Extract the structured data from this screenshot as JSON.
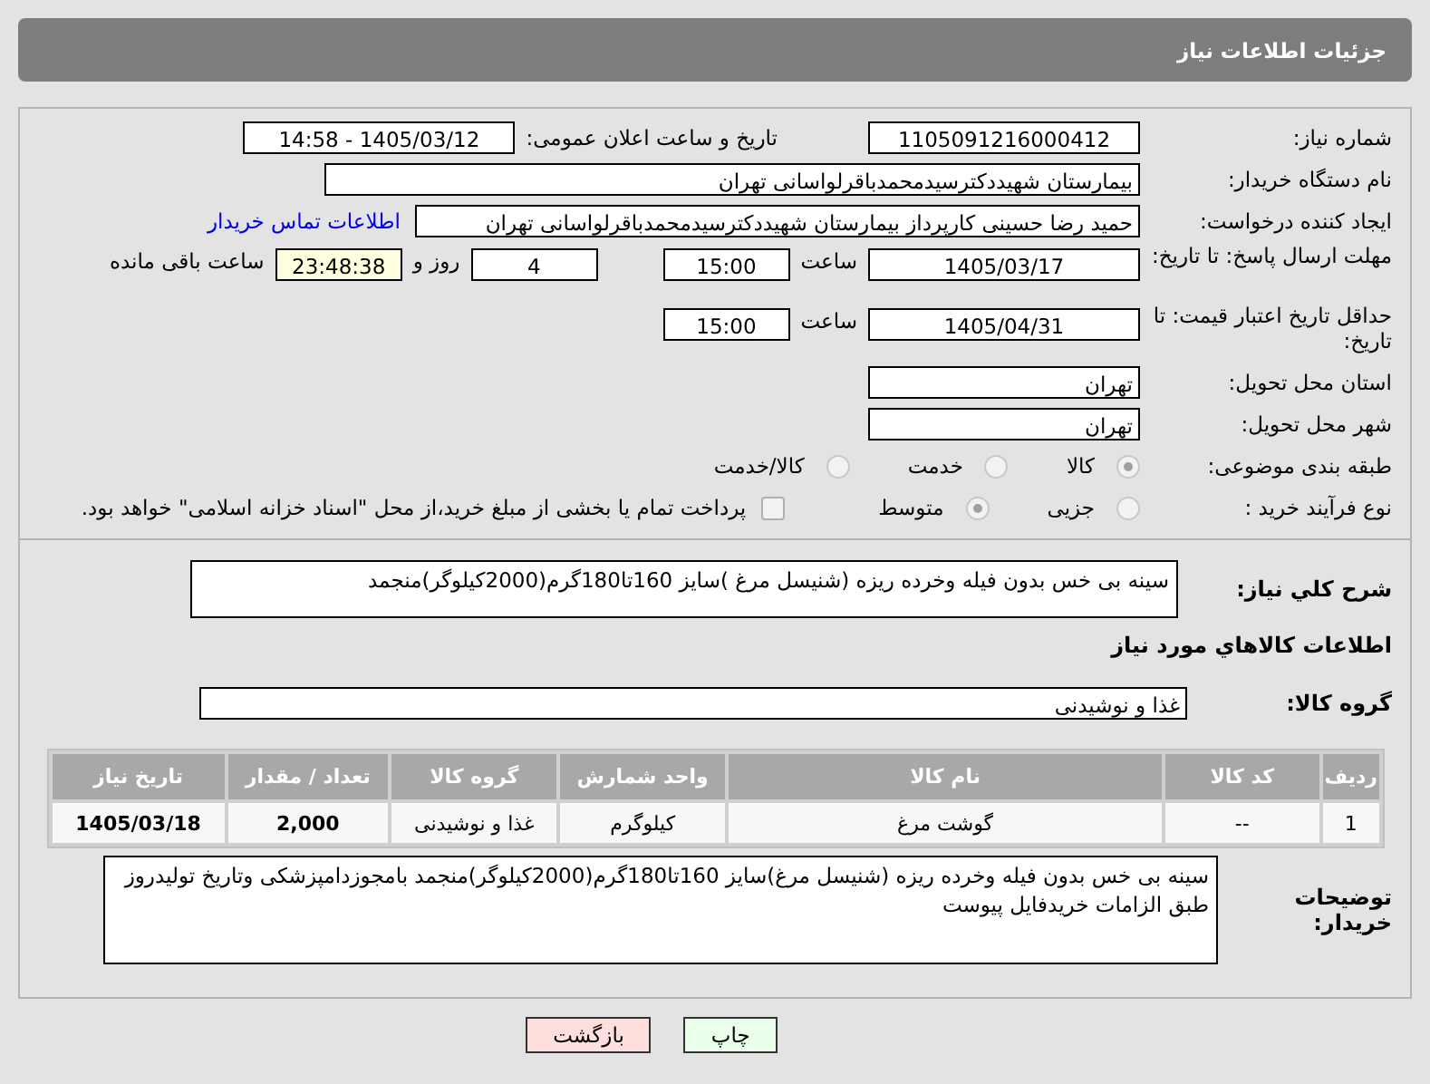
{
  "title": "جزئیات اطلاعات نیاز",
  "need_number": {
    "label": "شماره نیاز:",
    "value": "1105091216000412"
  },
  "announce": {
    "label": "تاریخ و ساعت اعلان عمومی:",
    "value": "1405/03/12 - 14:58"
  },
  "buyer_org": {
    "label": "نام دستگاه خریدار:",
    "value": "بیمارستان شهیددکترسیدمحمدباقرلواسانی تهران"
  },
  "requester": {
    "label": "ایجاد کننده درخواست:",
    "value": "حمید رضا  حسینی کارپرداز بیمارستان شهیددکترسیدمحمدباقرلواسانی تهران",
    "link": "اطلاعات تماس خریدار"
  },
  "reply_deadline": {
    "label": "مهلت ارسال پاسخ: تا تاریخ:",
    "date": "1405/03/17",
    "time_label": "ساعت",
    "time": "15:00",
    "days": "4",
    "days_label": "روز و",
    "remaining": "23:48:38",
    "remaining_label": "ساعت باقی مانده"
  },
  "price_validity": {
    "label": "حداقل تاریخ اعتبار قیمت: تا تاریخ:",
    "date": "1405/04/31",
    "time_label": "ساعت",
    "time": "15:00"
  },
  "province": {
    "label": "استان محل تحویل:",
    "value": "تهران"
  },
  "city": {
    "label": "شهر محل تحویل:",
    "value": "تهران"
  },
  "category": {
    "label": "طبقه بندی موضوعی:",
    "options": [
      {
        "label": "کالا",
        "selected": true
      },
      {
        "label": "خدمت",
        "selected": false
      },
      {
        "label": "کالا/خدمت",
        "selected": false
      }
    ]
  },
  "process": {
    "label": "نوع فرآیند خرید :",
    "options": [
      {
        "label": "جزیی",
        "selected": false
      },
      {
        "label": "متوسط",
        "selected": true
      }
    ],
    "payment": {
      "label": "پرداخت تمام یا بخشی از مبلغ خرید،از محل \"اسناد خزانه اسلامی\" خواهد بود.",
      "checked": false
    }
  },
  "description": {
    "label": "شرح کلي نياز:",
    "value": "سینه بی خس بدون فیله وخرده ریزه (شنیسل مرغ )سایز 160تا180گرم(2000کیلوگر)منجمد"
  },
  "goods_heading": "اطلاعات کالاهاي مورد نياز",
  "goods_group": {
    "label": "گروه کالا:",
    "value": "غذا و نوشیدنی"
  },
  "table": {
    "columns": [
      "ردیف",
      "کد کالا",
      "نام کالا",
      "واحد شمارش",
      "گروه کالا",
      "تعداد / مقدار",
      "تاریخ نیاز"
    ],
    "rows": [
      [
        "1",
        "--",
        "گوشت مرغ",
        "کیلوگرم",
        "غذا و نوشیدنی",
        "2,000",
        "1405/03/18"
      ]
    ]
  },
  "buyer_notes": {
    "label": "توضیحات خریدار:",
    "value": "سینه بی خس بدون فیله وخرده ریزه (شنیسل مرغ)سایز 160تا180گرم(2000کیلوگر)منجمد بامجوزدامپزشکی وتاریخ تولیدروز\nطبق الزامات خریدفایل پیوست"
  },
  "buttons": [
    {
      "label": "چاپ",
      "kind": "print"
    },
    {
      "label": "بازگشت",
      "kind": "back"
    }
  ]
}
